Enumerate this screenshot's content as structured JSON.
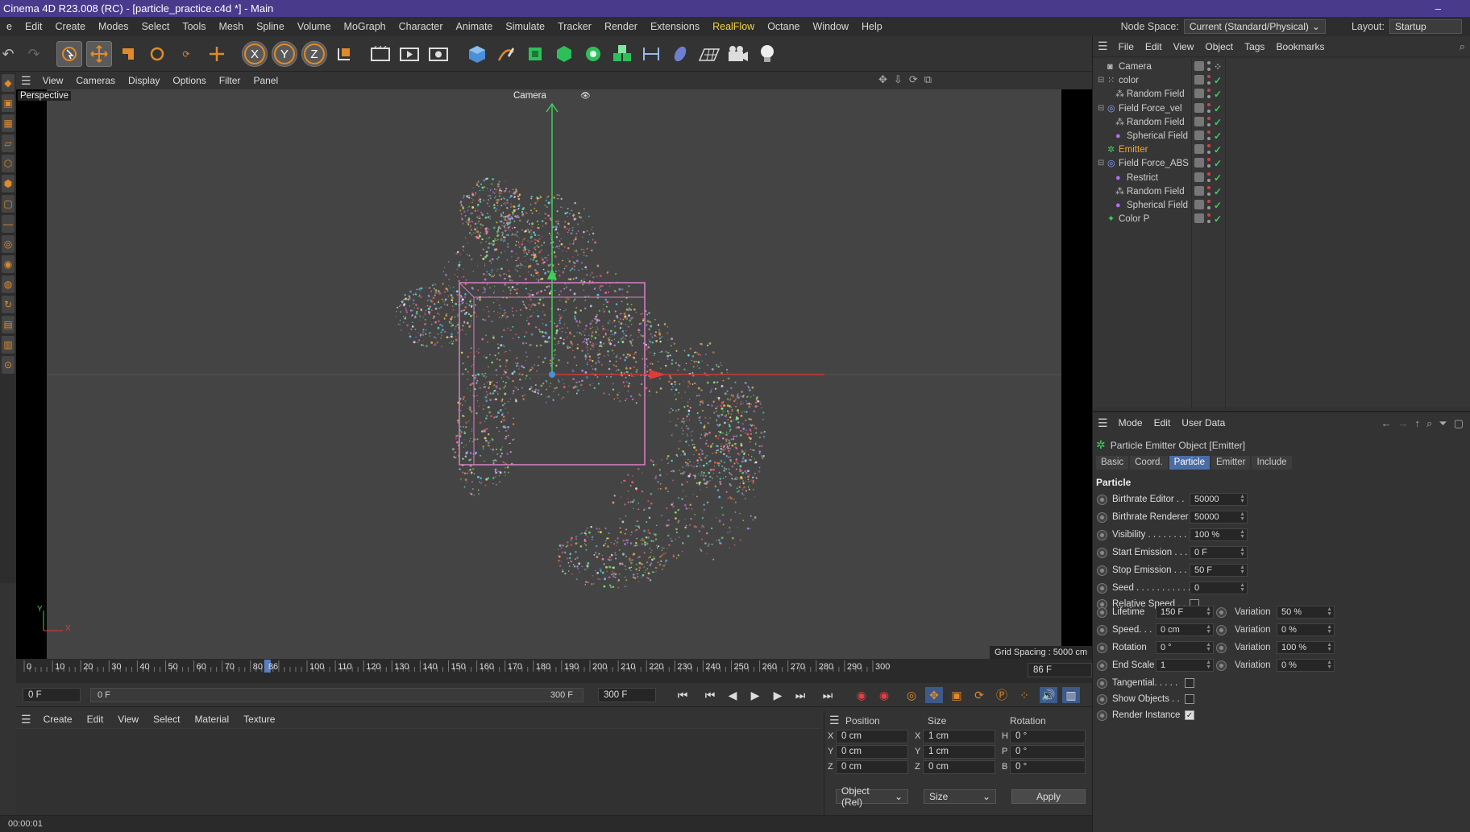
{
  "window": {
    "title": "Cinema 4D R23.008 (RC) - [particle_practice.c4d *] - Main",
    "minimize": "–"
  },
  "menubar": {
    "items": [
      "e",
      "Edit",
      "Create",
      "Modes",
      "Select",
      "Tools",
      "Mesh",
      "Spline",
      "Volume",
      "MoGraph",
      "Character",
      "Animate",
      "Simulate",
      "Tracker",
      "Render",
      "Extensions",
      "RealFlow",
      "Octane",
      "Window",
      "Help"
    ],
    "node_space_label": "Node Space:",
    "node_space_value": "Current (Standard/Physical)",
    "layout_label": "Layout:",
    "layout_value": "Startup"
  },
  "toolbar": {
    "icons": [
      "undo-icon",
      "redo-icon",
      "select-icon",
      "move-icon",
      "scale-icon",
      "rotate-icon",
      "recent-tool-icon",
      "transform-icon",
      "x-axis-icon",
      "y-axis-icon",
      "z-axis-icon",
      "coordinate-system-icon",
      "render-view-icon",
      "render-picture-viewer-icon",
      "render-settings-icon",
      "cube-icon",
      "pen-icon",
      "subdivision-icon",
      "extrude-icon",
      "cloner-icon",
      "mograph-icon",
      "measure-icon",
      "deformer-icon",
      "floor-icon",
      "camera-icon",
      "light-icon"
    ],
    "axis_labels": [
      "X",
      "Y",
      "Z"
    ]
  },
  "viewport": {
    "menu": [
      "View",
      "Cameras",
      "Display",
      "Options",
      "Filter",
      "Panel"
    ],
    "label": "Perspective",
    "camera_label": "Camera",
    "grid_spacing": "Grid Spacing : 5000 cm",
    "axis_y": "Y",
    "axis_x": "X"
  },
  "timeline": {
    "ticks": [
      "0",
      "10",
      "20",
      "30",
      "40",
      "50",
      "60",
      "70",
      "80",
      "86",
      "100",
      "110",
      "120",
      "130",
      "140",
      "150",
      "160",
      "170",
      "180",
      "190",
      "200",
      "210",
      "220",
      "230",
      "240",
      "250",
      "260",
      "270",
      "280",
      "290",
      "300"
    ],
    "current_frame": "86 F",
    "playhead_label": "86"
  },
  "transport": {
    "start_field": "0 F",
    "range_start": "0 F",
    "range_end": "300 F",
    "end_field": "300 F"
  },
  "material_manager": {
    "menu": [
      "Create",
      "Edit",
      "View",
      "Select",
      "Material",
      "Texture"
    ]
  },
  "coordinates": {
    "headers": [
      "Position",
      "Size",
      "Rotation"
    ],
    "rows": [
      {
        "axis": "X",
        "pos": "0 cm",
        "size_axis": "X",
        "size": "1 cm",
        "rot_axis": "H",
        "rot": "0 °"
      },
      {
        "axis": "Y",
        "pos": "0 cm",
        "size_axis": "Y",
        "size": "1 cm",
        "rot_axis": "P",
        "rot": "0 °"
      },
      {
        "axis": "Z",
        "pos": "0 cm",
        "size_axis": "Z",
        "size": "0 cm",
        "rot_axis": "B",
        "rot": "0 °"
      }
    ],
    "mode_select": "Object (Rel)",
    "size_select": "Size",
    "apply": "Apply"
  },
  "status": {
    "time": "00:00:01"
  },
  "object_manager": {
    "menu": [
      "File",
      "Edit",
      "View",
      "Object",
      "Tags",
      "Bookmarks"
    ],
    "objects": [
      {
        "name": "Camera",
        "indent": 0,
        "color": "#cfcfcf"
      },
      {
        "name": "color",
        "indent": 0,
        "color": "#cfcfcf"
      },
      {
        "name": "Random Field",
        "indent": 1,
        "color": "#cfcfcf"
      },
      {
        "name": "Field Force_vel",
        "indent": 0,
        "color": "#cfcfcf"
      },
      {
        "name": "Random Field",
        "indent": 1,
        "color": "#cfcfcf"
      },
      {
        "name": "Spherical Field",
        "indent": 1,
        "color": "#cfcfcf"
      },
      {
        "name": "Emitter",
        "indent": 0,
        "color": "#f0a830"
      },
      {
        "name": "Field Force_ABS",
        "indent": 0,
        "color": "#cfcfcf"
      },
      {
        "name": "Restrict",
        "indent": 1,
        "color": "#cfcfcf"
      },
      {
        "name": "Random Field",
        "indent": 1,
        "color": "#cfcfcf"
      },
      {
        "name": "Spherical Field",
        "indent": 1,
        "color": "#cfcfcf"
      },
      {
        "name": "Color P",
        "indent": 0,
        "color": "#cfcfcf"
      }
    ]
  },
  "attributes": {
    "menu": [
      "Mode",
      "Edit",
      "User Data"
    ],
    "object_title": "Particle Emitter Object [Emitter]",
    "tabs": [
      "Basic",
      "Coord.",
      "Particle",
      "Emitter",
      "Include"
    ],
    "active_tab": "Particle",
    "section": "Particle",
    "params": [
      {
        "label": "Birthrate Editor . .",
        "value": "50000"
      },
      {
        "label": "Birthrate Renderer",
        "value": "50000"
      },
      {
        "label": "Visibility . . . . . . . .",
        "value": "100 %"
      },
      {
        "label": "Start Emission . . .",
        "value": "0 F"
      },
      {
        "label": "Stop Emission . . .",
        "value": "50 F"
      },
      {
        "label": "Seed . . . . . . . . . . .",
        "value": "0"
      }
    ],
    "relative_speed": "Relative Speed . .",
    "variations": [
      {
        "label": "Lifetime",
        "value": "150 F",
        "var_label": "Variation",
        "var": "50 %"
      },
      {
        "label": "Speed. . .",
        "value": "0 cm",
        "var_label": "Variation",
        "var": "0 %"
      },
      {
        "label": "Rotation",
        "value": "0 °",
        "var_label": "Variation",
        "var": "100 %"
      },
      {
        "label": "End Scale",
        "value": "1",
        "var_label": "Variation",
        "var": "0 %"
      }
    ],
    "tangential": "Tangential. . . . .",
    "show_objects": "Show Objects . .",
    "render_instance": "Render Instance",
    "render_instance_checked": true
  }
}
